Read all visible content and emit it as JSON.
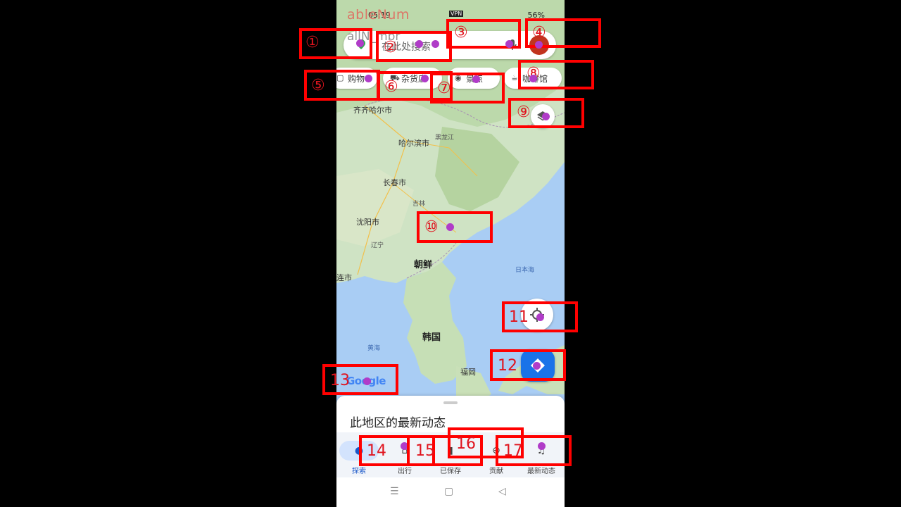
{
  "status_bar": {
    "time": "05:19",
    "vpn": "VPN",
    "battery": "56%"
  },
  "overlay_text": {
    "watermark": "ableNum",
    "watermark2": "allN_mbr"
  },
  "search": {
    "placeholder": "在此处搜索"
  },
  "chips": [
    {
      "label": "购物",
      "icon": "shopping-bag-icon"
    },
    {
      "label": "杂货店",
      "icon": "cart-icon"
    },
    {
      "label": "景点",
      "icon": "camera-icon"
    },
    {
      "label": "咖啡馆",
      "icon": "coffee-icon"
    }
  ],
  "map_labels": {
    "qiqihar": "齐齐哈尔市",
    "heilongjiang": "黑龙江",
    "harbin": "哈尔滨市",
    "changchun": "长春市",
    "jilin": "吉林",
    "shenyang": "沈阳市",
    "liaoning": "辽宁",
    "north_korea": "朝鲜",
    "dalian": "连市",
    "sea_of_japan": "日本海",
    "south_korea": "韩国",
    "yellow_sea": "黄海",
    "fukuoka": "福岡"
  },
  "google_logo": "Google",
  "sheet": {
    "title": "此地区的最新动态"
  },
  "bottom_nav": [
    {
      "label": "探索",
      "icon": "location-pin-icon",
      "active": true
    },
    {
      "label": "出行",
      "icon": "commute-icon",
      "active": false
    },
    {
      "label": "已保存",
      "icon": "bookmark-icon",
      "active": false
    },
    {
      "label": "贡献",
      "icon": "add-circle-icon",
      "active": false
    },
    {
      "label": "最新动态",
      "icon": "bell-icon",
      "active": false
    }
  ],
  "system_nav": [
    "☰",
    "▢",
    "◁"
  ],
  "annotations": [
    "①",
    "②",
    "③",
    "④",
    "⑤",
    "⑥",
    "⑦",
    "⑧",
    "⑨",
    "⑩",
    "11",
    "12",
    "13",
    "14",
    "15",
    "16",
    "17"
  ],
  "colors": {
    "annotation": "#ff0000",
    "marker_dot": "#b03cc8",
    "accent_blue": "#1a73e8"
  }
}
